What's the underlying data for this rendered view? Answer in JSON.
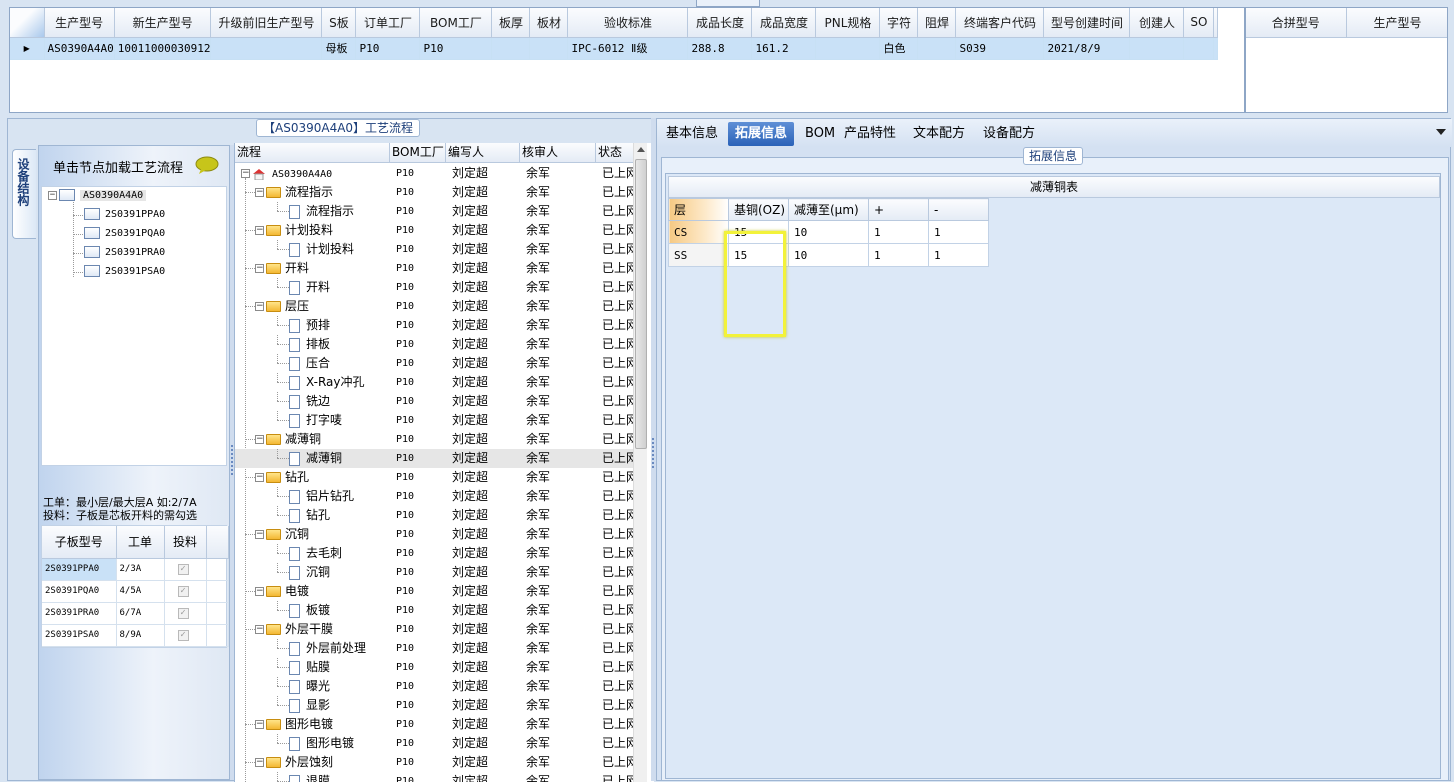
{
  "main_grid": {
    "columns": [
      "生产型号",
      "新生产型号",
      "升级前旧生产型号",
      "S板",
      "订单工厂",
      "BOM工厂",
      "板厚",
      "板材",
      "验收标准",
      "成品长度",
      "成品宽度",
      "PNL规格",
      "字符",
      "阻焊",
      "终端客户代码",
      "型号创建时间",
      "创建人",
      "SO"
    ],
    "row": [
      "AS0390A4A0",
      "10011000030912",
      "",
      "母板",
      "P10",
      "P10",
      "",
      "",
      "IPC-6012 Ⅱ级",
      "288.8",
      "161.2",
      "",
      "白色",
      "",
      "S039",
      "2021/8/9",
      "",
      ""
    ]
  },
  "merge_grid": {
    "columns": [
      "合拼型号",
      "生产型号"
    ]
  },
  "left": {
    "title": "【AS0390A4A0】工艺流程",
    "vertical_tab": "设备结构",
    "nav_hint": "单击节点加载工艺流程",
    "tree_root": "AS0390A4A0",
    "tree_children": [
      "2S0391PPA0",
      "2S0391PQA0",
      "2S0391PRA0",
      "2S0391PSA0"
    ],
    "note1": "工单：最小层/最大层A 如:2/7A",
    "note2": "投料：子板是芯板开料的需勾选",
    "sub_columns": [
      "子板型号",
      "工单",
      "投料"
    ],
    "sub_rows": [
      {
        "model": "2S0391PPA0",
        "order": "2/3A",
        "check": "✓"
      },
      {
        "model": "2S0391PQA0",
        "order": "4/5A",
        "check": "✓"
      },
      {
        "model": "2S0391PRA0",
        "order": "6/7A",
        "check": "✓"
      },
      {
        "model": "2S0391PSA0",
        "order": "8/9A",
        "check": "✓"
      }
    ]
  },
  "process": {
    "columns": [
      "流程",
      "BOM工厂",
      "编写人",
      "核审人",
      "状态"
    ],
    "root": "AS0390A4A0",
    "bom": "P10",
    "writer": "刘定超",
    "reviewer": "余军",
    "status": "已上网",
    "rows": [
      {
        "name": "流程指示",
        "level": 1
      },
      {
        "name": "流程指示",
        "level": 2
      },
      {
        "name": "计划投料",
        "level": 1
      },
      {
        "name": "计划投料",
        "level": 2
      },
      {
        "name": "开料",
        "level": 1
      },
      {
        "name": "开料",
        "level": 2
      },
      {
        "name": "层压",
        "level": 1
      },
      {
        "name": "预排",
        "level": 2
      },
      {
        "name": "排板",
        "level": 2
      },
      {
        "name": "压合",
        "level": 2
      },
      {
        "name": "X-Ray冲孔",
        "level": 2
      },
      {
        "name": "铣边",
        "level": 2
      },
      {
        "name": "打字唛",
        "level": 2
      },
      {
        "name": "减薄铜",
        "level": 1
      },
      {
        "name": "减薄铜",
        "level": 2
      },
      {
        "name": "钻孔",
        "level": 1
      },
      {
        "name": "铝片钻孔",
        "level": 2
      },
      {
        "name": "钻孔",
        "level": 2
      },
      {
        "name": "沉铜",
        "level": 1
      },
      {
        "name": "去毛刺",
        "level": 2
      },
      {
        "name": "沉铜",
        "level": 2
      },
      {
        "name": "电镀",
        "level": 1
      },
      {
        "name": "板镀",
        "level": 2
      },
      {
        "name": "外层干膜",
        "level": 1
      },
      {
        "name": "外层前处理",
        "level": 2
      },
      {
        "name": "贴膜",
        "level": 2
      },
      {
        "name": "曝光",
        "level": 2
      },
      {
        "name": "显影",
        "level": 2
      },
      {
        "name": "图形电镀",
        "level": 1
      },
      {
        "name": "图形电镀",
        "level": 2
      },
      {
        "name": "外层蚀刻",
        "level": 1
      },
      {
        "name": "退膜",
        "level": 2
      }
    ]
  },
  "right": {
    "tabs": [
      "基本信息",
      "拓展信息",
      "BOM",
      "产品特性",
      "文本配方",
      "设备配方"
    ],
    "group_title": "拓展信息",
    "table_caption": "减薄铜表",
    "table_columns": [
      "层",
      "基铜(OZ)",
      "减薄至(μm)",
      "+",
      "-"
    ],
    "table_rows": [
      [
        "CS",
        "15",
        "10",
        "1",
        "1"
      ],
      [
        "SS",
        "15",
        "10",
        "1",
        "1"
      ]
    ]
  }
}
